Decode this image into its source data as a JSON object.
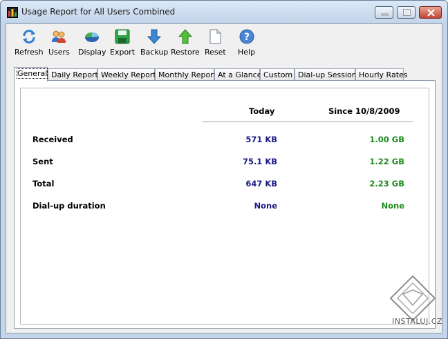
{
  "window": {
    "title": "Usage Report for All Users Combined"
  },
  "toolbar": {
    "items": [
      {
        "label": "Refresh",
        "icon": "refresh-icon"
      },
      {
        "label": "Users",
        "icon": "users-icon"
      },
      {
        "label": "Display",
        "icon": "display-icon"
      },
      {
        "label": "Export",
        "icon": "floppy-disk-icon"
      },
      {
        "label": "Backup",
        "icon": "arrow-down-icon"
      },
      {
        "label": "Restore",
        "icon": "arrow-up-icon"
      },
      {
        "label": "Reset",
        "icon": "blank-page-icon"
      },
      {
        "label": "Help",
        "icon": "help-icon"
      }
    ]
  },
  "tabs": [
    {
      "label": "General",
      "active": true
    },
    {
      "label": "Daily Report"
    },
    {
      "label": "Weekly Report"
    },
    {
      "label": "Monthly Report"
    },
    {
      "label": "At a Glance"
    },
    {
      "label": "Custom"
    },
    {
      "label": "Dial-up Sessions"
    },
    {
      "label": "Hourly Rates"
    }
  ],
  "general": {
    "columns": {
      "today": "Today",
      "since": "Since 10/8/2009"
    },
    "rows": [
      {
        "label": "Received",
        "today": "571 KB",
        "since": "1.00 GB"
      },
      {
        "label": "Sent",
        "today": "75.1 KB",
        "since": "1.22 GB"
      },
      {
        "label": "Total",
        "today": "647 KB",
        "since": "2.23 GB"
      },
      {
        "label": "Dial-up duration",
        "today": "None",
        "since": "None"
      }
    ]
  },
  "watermark": {
    "text": "INSTALUJ.CZ"
  },
  "colors": {
    "today_value": "#1b1b86",
    "since_value": "#1c8a1c",
    "titlebar": "#c3d4ea"
  }
}
